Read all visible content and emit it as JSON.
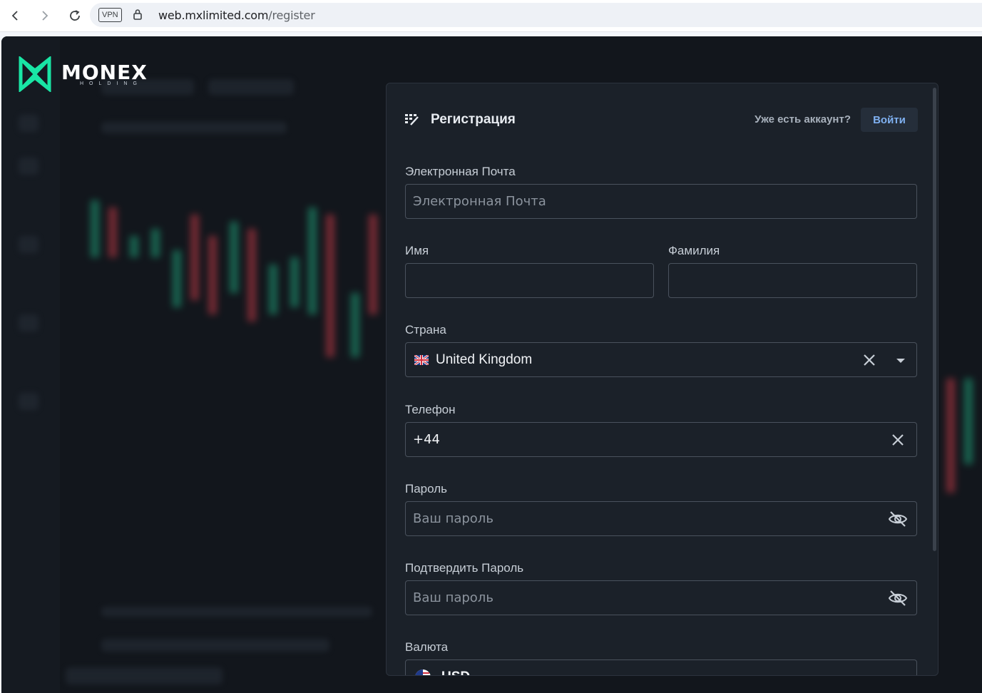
{
  "browser": {
    "vpn_label": "VPN",
    "url_host": "web.mxlimited.com",
    "url_path": "/register"
  },
  "logo": {
    "name": "MONEX",
    "subtitle": "HOLDING"
  },
  "registration": {
    "title": "Регистрация",
    "have_account": "Уже есть аккаунт?",
    "login_label": "Войти",
    "email": {
      "label": "Электронная Почта",
      "placeholder": "Электронная Почта",
      "value": ""
    },
    "first_name": {
      "label": "Имя",
      "value": ""
    },
    "last_name": {
      "label": "Фамилия",
      "value": ""
    },
    "country": {
      "label": "Страна",
      "value": "United Kingdom",
      "flag": "uk-flag-icon"
    },
    "phone": {
      "label": "Телефон",
      "value": "+44"
    },
    "password": {
      "label": "Пароль",
      "placeholder": "Ваш пароль",
      "value": ""
    },
    "confirm_password": {
      "label": "Подтвердить Пароль",
      "placeholder": "Ваш пароль",
      "value": ""
    },
    "currency": {
      "label": "Валюта",
      "value": "USD",
      "flag": "us-flag-icon"
    }
  },
  "colors": {
    "panel_bg": "#1b2129",
    "accent_blue": "#7fb0f0",
    "logo_green": "#19e6a5"
  }
}
